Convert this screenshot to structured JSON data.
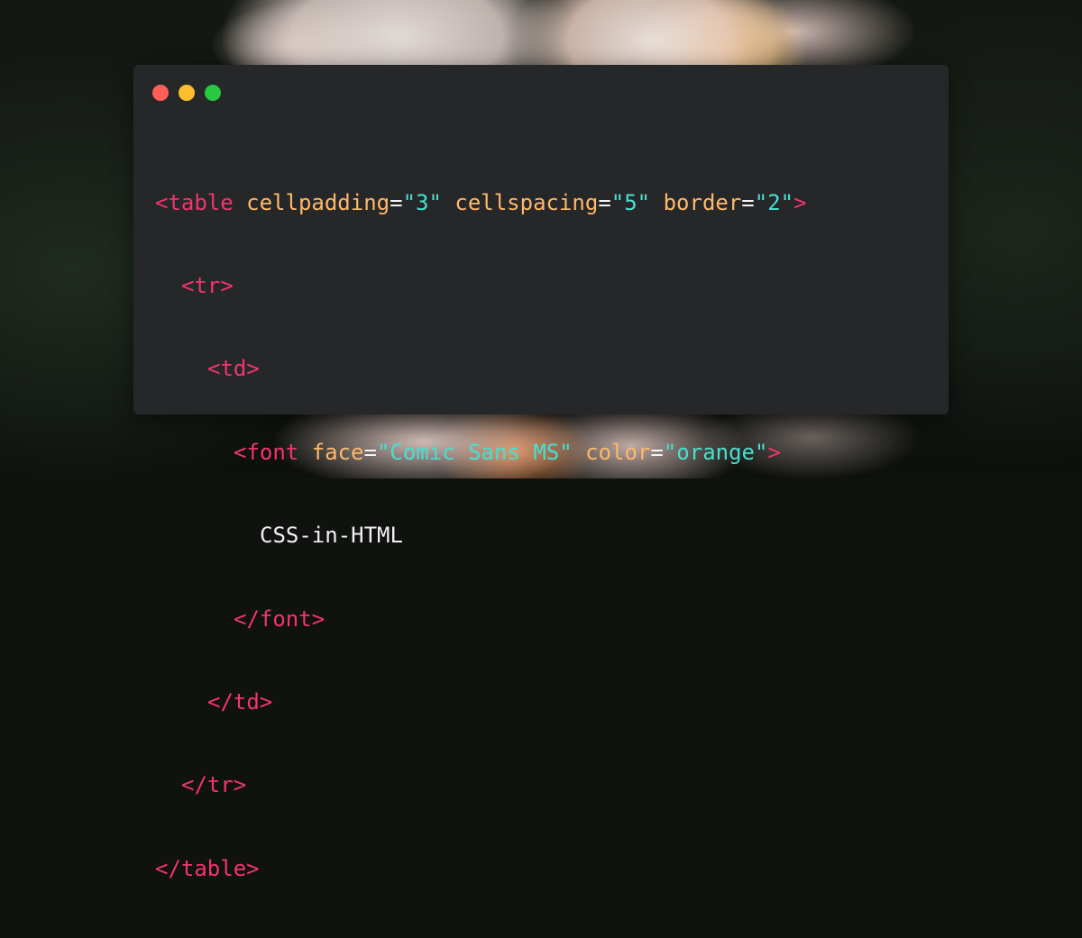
{
  "window": {
    "controls": [
      {
        "name": "close",
        "color": "#ff5f57"
      },
      {
        "name": "minimize",
        "color": "#febc2e"
      },
      {
        "name": "maximize",
        "color": "#28c840"
      }
    ]
  },
  "code": {
    "lines": [
      {
        "open": "<table",
        "attr1": "cellpadding",
        "eq1": "=",
        "val1": "\"3\"",
        "attr2": "cellspacing",
        "eq2": "=",
        "val2": "\"5\"",
        "attr3": "border",
        "eq3": "=",
        "val3": "\"2\"",
        "close": ">"
      },
      {
        "tag": "<tr>"
      },
      {
        "tag": "<td>"
      },
      {
        "open": "<font",
        "attr1": "face",
        "eq1": "=",
        "val1": "\"Comic Sans MS\"",
        "attr2": "color",
        "eq2": "=",
        "val2": "\"orange\"",
        "close": ">"
      },
      {
        "text": "CSS-in-HTML"
      },
      {
        "tag": "</font>"
      },
      {
        "tag": "</td>"
      },
      {
        "tag": "</tr>"
      },
      {
        "tag": "</table>"
      }
    ]
  },
  "colors": {
    "tag": "#f2356c",
    "attribute": "#ffb86b",
    "string": "#46e0d0",
    "text": "#f2f2f2",
    "editor_background": "#262729"
  }
}
